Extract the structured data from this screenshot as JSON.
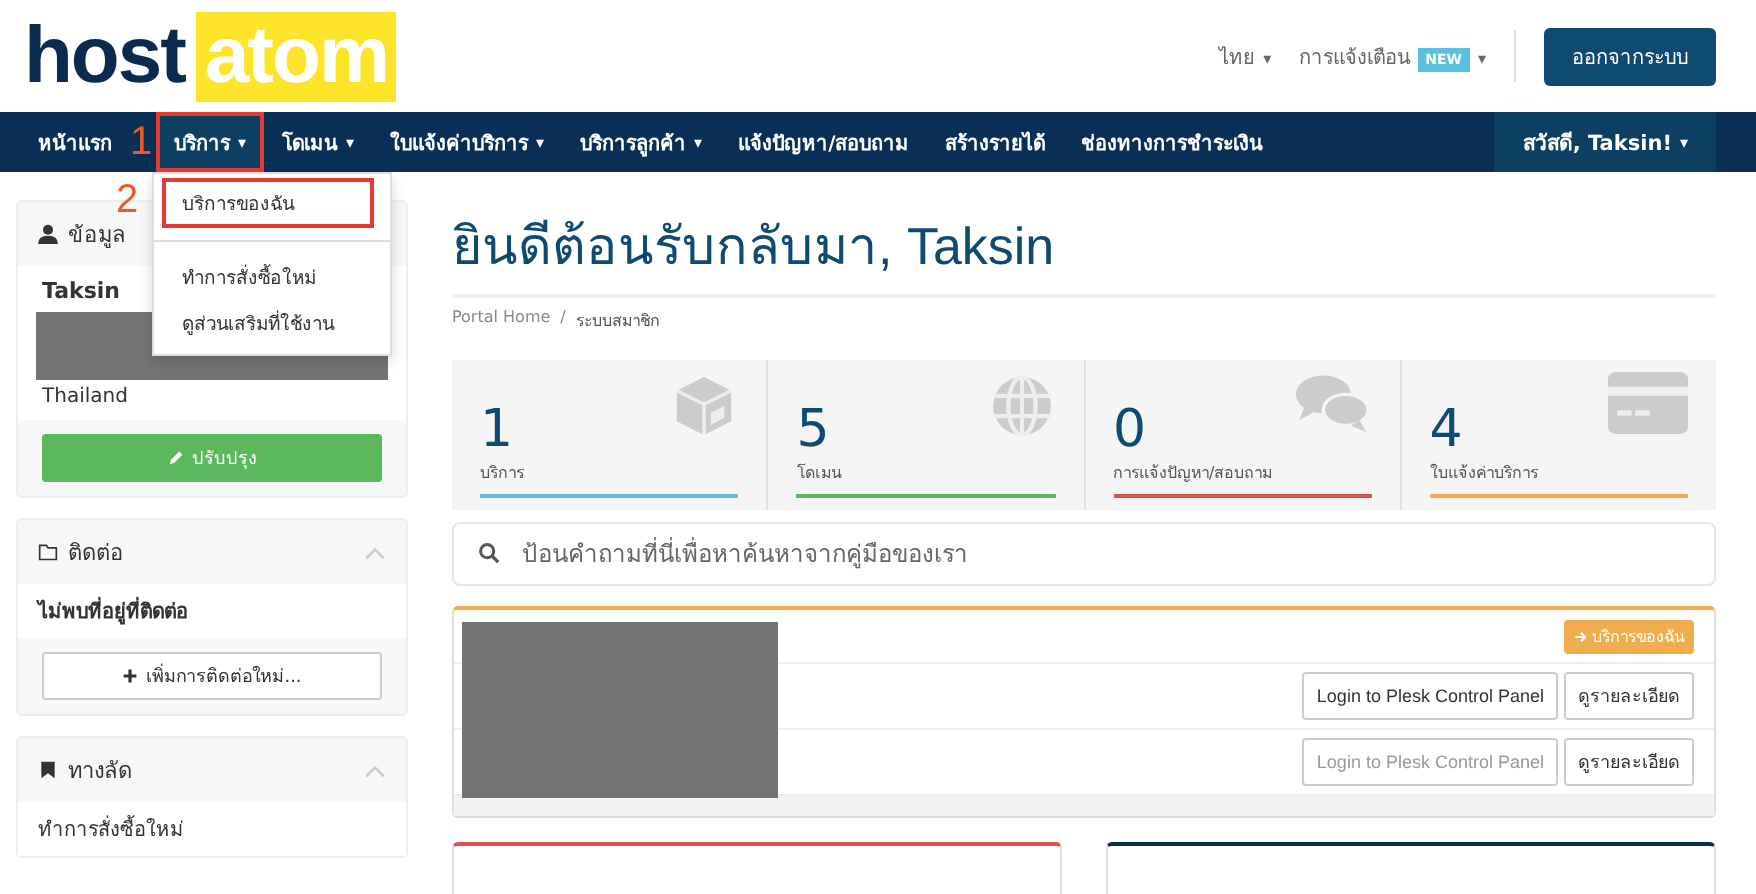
{
  "logo": {
    "part_1": "host",
    "part_2": "atom"
  },
  "top_links": [
    {
      "label": "ไทย",
      "caret": "▾"
    },
    {
      "label": "การแจ้งเตือน",
      "badge": "NEW",
      "caret": "▾"
    }
  ],
  "logout_button": "ออกจากระบบ",
  "nav": {
    "items": [
      {
        "label": "หน้าแรก",
        "selected": false
      },
      {
        "label": "บริการ",
        "caret": "▾",
        "selected": true,
        "callout": "1"
      },
      {
        "label": "โดเมน",
        "caret": "▾",
        "selected": false
      },
      {
        "label": "ใบแจ้งค่าบริการ",
        "caret": "▾",
        "selected": false
      },
      {
        "label": "บริการลูกค้า",
        "caret": "▾",
        "selected": false
      },
      {
        "label": "แจ้งปัญหา/สอบถาม",
        "selected": false
      },
      {
        "label": "สร้างรายได้",
        "selected": false
      },
      {
        "label": "ช่องทางการชำระเงิน",
        "selected": false
      }
    ],
    "user_menu": "สวัสดี, Taksin!",
    "user_caret": "▾"
  },
  "dropdown": {
    "items": [
      {
        "label": "บริการของฉัน",
        "selected": true,
        "callout": "2"
      },
      {
        "label": "ทำการสั่งซื้อใหม่",
        "selected": false
      },
      {
        "label": "ดูส่วนเสริมที่ใช้งาน",
        "selected": false
      }
    ]
  },
  "sidebar": {
    "panels": [
      {
        "kind": "profile",
        "title": "ข้อมูล",
        "name": "Taksin",
        "country": "Thailand",
        "button": "ปรับปรุง"
      },
      {
        "kind": "contacts",
        "title": "ติดต่อ",
        "text": "ไม่พบที่อยู่ที่ติดต่อ",
        "button": "เพิ่มการติดต่อใหม่..."
      },
      {
        "kind": "shortcuts",
        "title": "ทางลัด",
        "text": "ทำการสั่งซื้อใหม่"
      }
    ]
  },
  "main": {
    "title": "ยินดีต้อนรับกลับมา, Taksin",
    "breadcrumb": [
      "Portal Home",
      "ระบบสมาชิก"
    ],
    "breadcrumb_separator": "/",
    "stats": [
      {
        "kind": "box",
        "value": "1",
        "label": "บริการ",
        "color": "#5bc0de"
      },
      {
        "kind": "globe",
        "value": "5",
        "label": "โดเมน",
        "color": "#5cb85c"
      },
      {
        "kind": "chat",
        "value": "0",
        "label": "การแจ้งปัญหา/สอบถาม",
        "color": "#d9534f"
      },
      {
        "kind": "card",
        "value": "4",
        "label": "ใบแจ้งค่าบริการ",
        "color": "#f0ad4e"
      }
    ],
    "search": {
      "placeholder": "ป้อนคำถามที่นี่เพื่อหาค้นหาจากคู่มือของเรา"
    },
    "services": {
      "header_button": "บริการของฉัน",
      "rows": [
        {
          "login_button": "Login to Plesk Control Panel",
          "disabled": false,
          "details_button": "ดูรายละเอียด"
        },
        {
          "login_button": "Login to Plesk Control Panel",
          "disabled": true,
          "details_button": "ดูรายละเอียด"
        }
      ]
    }
  }
}
